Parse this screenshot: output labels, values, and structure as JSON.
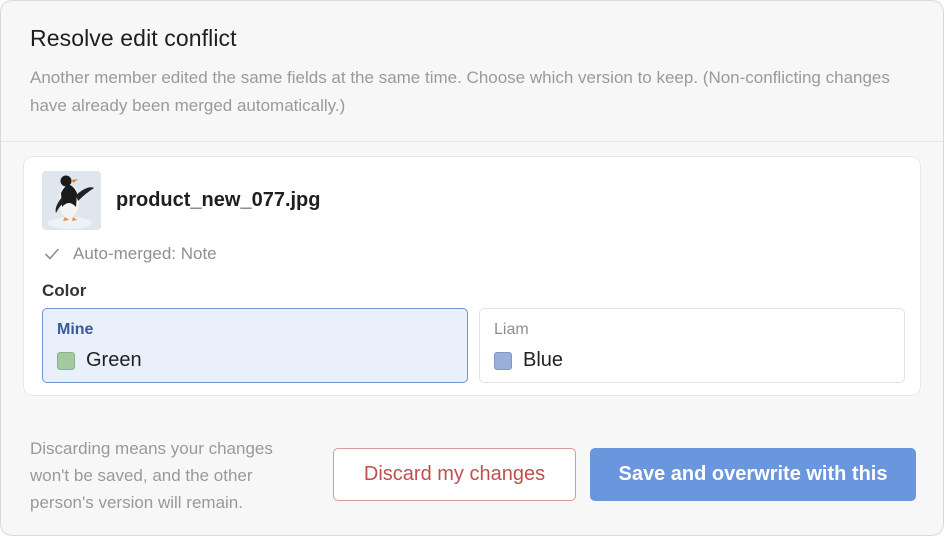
{
  "dialog": {
    "title": "Resolve edit conflict",
    "description": "Another member edited the same fields at the same time. Choose which version to keep. (Non-conflicting changes have already been merged automatically.)"
  },
  "item": {
    "filename": "product_new_077.jpg",
    "auto_merged_text": "Auto-merged: Note",
    "field_label": "Color",
    "options": [
      {
        "who": "Mine",
        "value": "Green",
        "swatch_color": "#a3c9a0",
        "selected": true
      },
      {
        "who": "Liam",
        "value": "Blue",
        "swatch_color": "#9bb0d8",
        "selected": false
      }
    ]
  },
  "footer": {
    "note": "Discarding means your changes won't be saved, and the other person's version will remain.",
    "discard_label": "Discard my changes",
    "save_label": "Save and overwrite with this"
  },
  "colors": {
    "accent": "#6a96dd",
    "danger": "#c0504f",
    "selected_bg": "#e9f0fb"
  },
  "icons": [
    "image-thumbnail",
    "check-icon"
  ]
}
